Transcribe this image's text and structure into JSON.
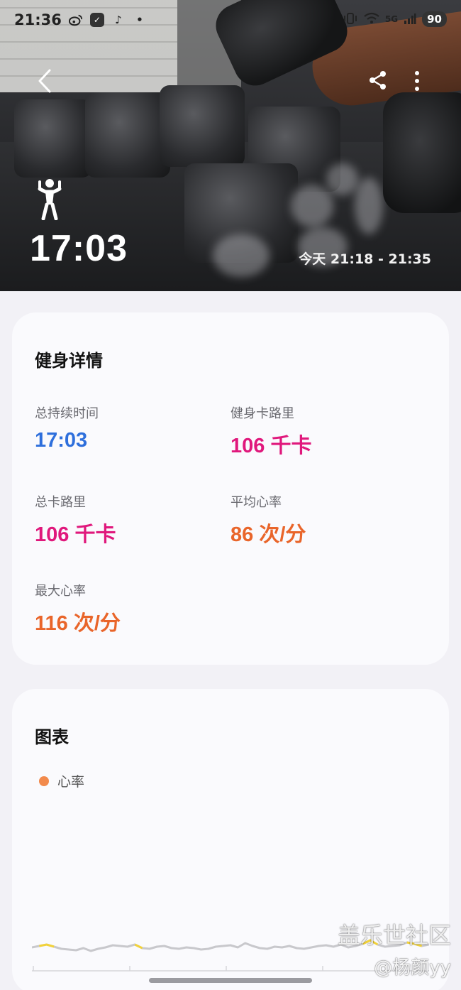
{
  "status_bar": {
    "time": "21:36",
    "battery": "90",
    "network": "5G"
  },
  "hero": {
    "duration": "17:03",
    "range": "今天 21:18 - 21:35"
  },
  "details": {
    "title": "健身详情",
    "metrics": [
      {
        "label": "总持续时间",
        "value": "17:03",
        "color": "#2e6fdc"
      },
      {
        "label": "健身卡路里",
        "value": "106 千卡",
        "color": "#e0187c"
      },
      {
        "label": "总卡路里",
        "value": "106 千卡",
        "color": "#e0187c"
      },
      {
        "label": "平均心率",
        "value": "86 次/分",
        "color": "#e9652a"
      },
      {
        "label": "最大心率",
        "value": "116 次/分",
        "color": "#e9652a"
      }
    ]
  },
  "chart_section": {
    "title": "图表",
    "legend_label": "心率",
    "colors": {
      "line": "#c8c8cc",
      "highlight": "#f2d23a",
      "legend_dot": "#f28a4c"
    }
  },
  "chart_data": {
    "type": "line",
    "series": [
      {
        "name": "心率",
        "values": [
          82,
          84,
          86,
          83,
          80,
          79,
          78,
          81,
          77,
          80,
          82,
          85,
          84,
          83,
          86,
          81,
          80,
          83,
          84,
          81,
          80,
          82,
          81,
          79,
          80,
          83,
          84,
          85,
          82,
          88,
          84,
          81,
          80,
          83,
          82,
          84,
          81,
          80,
          82,
          84,
          85,
          83,
          86,
          82,
          84,
          87,
          92,
          86,
          83,
          84,
          85,
          89,
          87,
          84,
          86
        ]
      }
    ],
    "xlabel": "",
    "ylabel": ""
  },
  "watermark": {
    "line1": "盖乐世社区",
    "line2": "@杨颜yy"
  }
}
